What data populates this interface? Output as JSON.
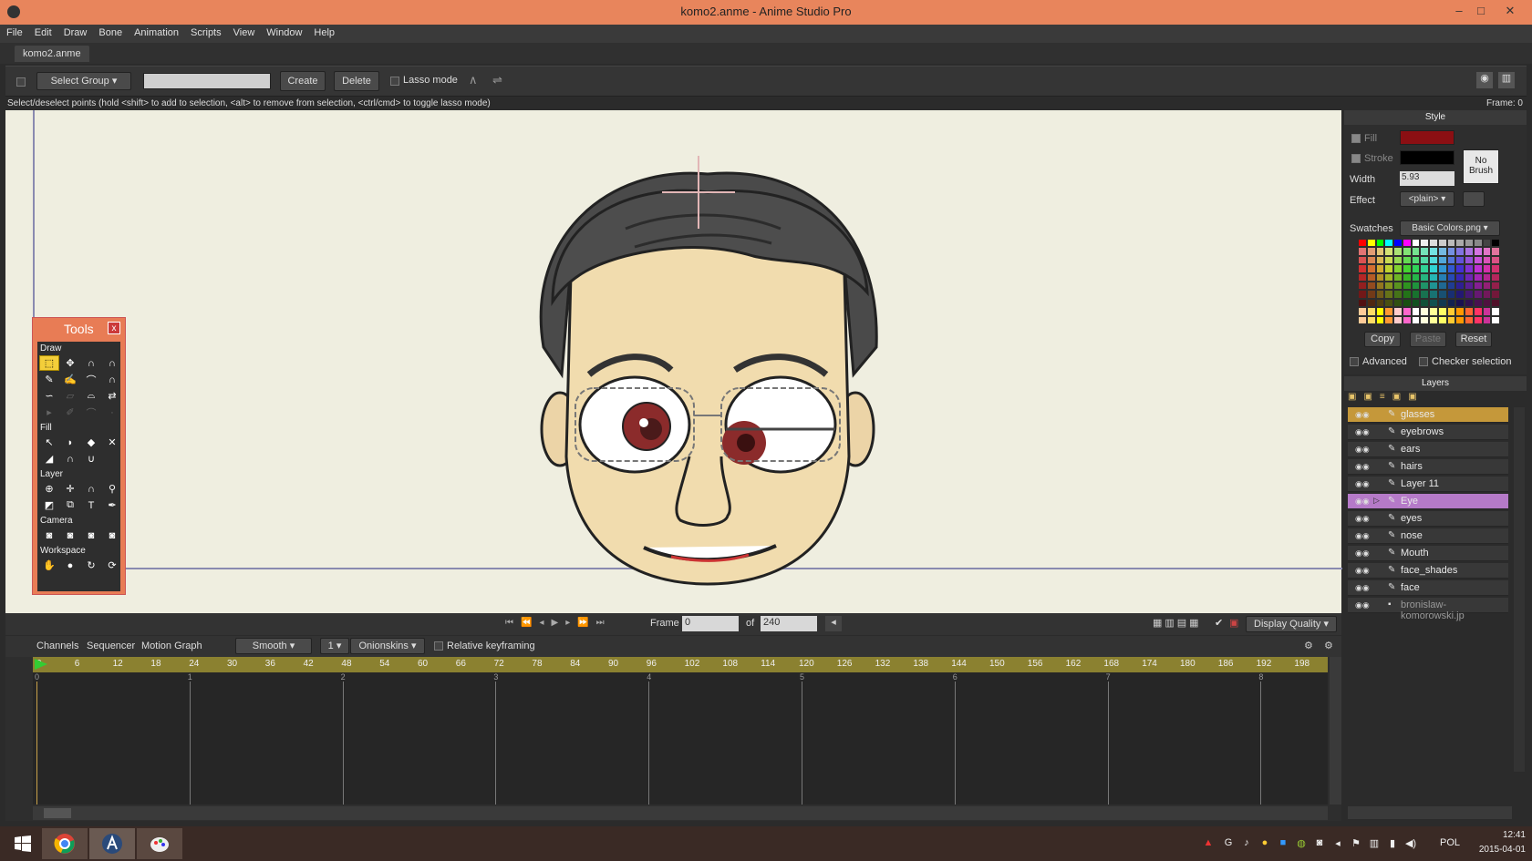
{
  "window": {
    "title": "komo2.anme - Anime Studio Pro",
    "min": "–",
    "max": "□",
    "close": "✕"
  },
  "menu": [
    "File",
    "Edit",
    "Draw",
    "Bone",
    "Animation",
    "Scripts",
    "View",
    "Window",
    "Help"
  ],
  "doc_tab": "komo2.anme",
  "toolbar": {
    "select_group": "Select Group",
    "create": "Create",
    "delete": "Delete",
    "lasso": "Lasso mode",
    "frame_label": "Frame: 0"
  },
  "hint": "Select/deselect points (hold <shift> to add to selection, <alt> to remove from selection, <ctrl/cmd> to toggle lasso mode)",
  "tools": {
    "title": "Tools",
    "close": "x",
    "sections": {
      "draw": "Draw",
      "fill": "Fill",
      "layer": "Layer",
      "camera": "Camera",
      "workspace": "Workspace"
    }
  },
  "playback": {
    "frame_label": "Frame",
    "frame_value": "0",
    "of_label": "of",
    "total": "240",
    "display_quality": "Display Quality"
  },
  "timeline": {
    "tabs": [
      "Channels",
      "Sequencer",
      "Motion Graph"
    ],
    "interp": "Smooth",
    "step": "1",
    "onionskins": "Onionskins",
    "relative": "Relative keyframing",
    "ruler": [
      "0",
      "6",
      "12",
      "18",
      "24",
      "30",
      "36",
      "42",
      "48",
      "54",
      "60",
      "66",
      "72",
      "78",
      "84",
      "90",
      "96",
      "102",
      "108",
      "114",
      "120",
      "126",
      "132",
      "138",
      "144",
      "150",
      "156",
      "162",
      "168",
      "174",
      "180",
      "186",
      "192",
      "198"
    ],
    "seconds": [
      "0",
      "1",
      "2",
      "3",
      "4",
      "5",
      "6",
      "7",
      "8"
    ]
  },
  "style": {
    "title": "Style",
    "fill": "Fill",
    "stroke": "Stroke",
    "width": "Width",
    "width_value": "5.93",
    "no_brush": "No Brush",
    "effect": "Effect",
    "effect_value": "<plain>",
    "swatches": "Swatches",
    "swatches_value": "Basic Colors.png",
    "copy": "Copy",
    "paste": "Paste",
    "reset": "Reset",
    "advanced": "Advanced",
    "checker": "Checker selection",
    "fill_color": "#8b0f13",
    "stroke_color": "#000000"
  },
  "layers": {
    "title": "Layers",
    "items": [
      {
        "name": "glasses",
        "state": "sel"
      },
      {
        "name": "eyebrows",
        "state": ""
      },
      {
        "name": "ears",
        "state": ""
      },
      {
        "name": "hairs",
        "state": ""
      },
      {
        "name": "Layer 11",
        "state": ""
      },
      {
        "name": "Eye",
        "state": "grp"
      },
      {
        "name": "eyes",
        "state": ""
      },
      {
        "name": "nose",
        "state": ""
      },
      {
        "name": "Mouth",
        "state": ""
      },
      {
        "name": "face_shades",
        "state": ""
      },
      {
        "name": "face",
        "state": ""
      },
      {
        "name": "bronislaw-komorowski.jp",
        "state": "img"
      }
    ]
  },
  "taskbar": {
    "lang": "POL",
    "time": "12:41",
    "date": "2015-04-01"
  }
}
